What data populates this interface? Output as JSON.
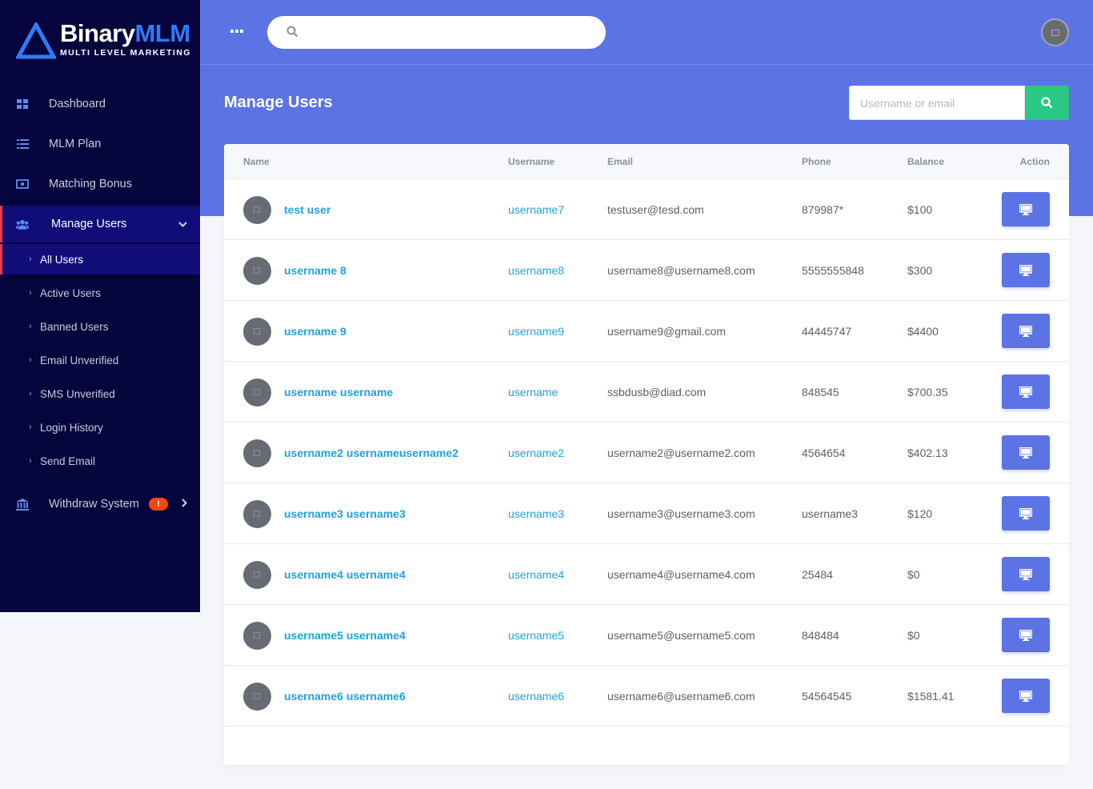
{
  "brand": {
    "name_part1": "Binary",
    "name_part2": "MLM",
    "tagline": "MULTI LEVEL MARKETING"
  },
  "sidebar": {
    "items": [
      {
        "label": "Dashboard",
        "icon": "dashboard-icon"
      },
      {
        "label": "MLM Plan",
        "icon": "list-icon"
      },
      {
        "label": "Matching Bonus",
        "icon": "money-icon"
      },
      {
        "label": "Manage Users",
        "icon": "users-icon"
      },
      {
        "label": "Withdraw System",
        "icon": "bank-icon",
        "badge": "!"
      }
    ],
    "subitems": [
      {
        "label": "All Users"
      },
      {
        "label": "Active Users"
      },
      {
        "label": "Banned Users"
      },
      {
        "label": "Email Unverified"
      },
      {
        "label": "SMS Unverified"
      },
      {
        "label": "Login History"
      },
      {
        "label": "Send Email"
      }
    ]
  },
  "topbar": {
    "search_placeholder": ""
  },
  "page": {
    "title": "Manage Users",
    "search_placeholder": "Username or email"
  },
  "table": {
    "columns": [
      "Name",
      "Username",
      "Email",
      "Phone",
      "Balance",
      "Action"
    ],
    "rows": [
      {
        "name": "test user",
        "username": "username7",
        "email": "testuser@tesd.com",
        "phone": "879987*",
        "balance": "$100"
      },
      {
        "name": "username 8",
        "username": "username8",
        "email": "username8@username8.com",
        "phone": "5555555848",
        "balance": "$300"
      },
      {
        "name": "username 9",
        "username": "username9",
        "email": "username9@gmail.com",
        "phone": "44445747",
        "balance": "$4400"
      },
      {
        "name": "username username",
        "username": "username",
        "email": "ssbdusb@diad.com",
        "phone": "848545",
        "balance": "$700.35"
      },
      {
        "name": "username2 usernameusername2",
        "username": "username2",
        "email": "username2@username2.com",
        "phone": "4564654",
        "balance": "$402.13"
      },
      {
        "name": "username3 username3",
        "username": "username3",
        "email": "username3@username3.com",
        "phone": "username3",
        "balance": "$120"
      },
      {
        "name": "username4 username4",
        "username": "username4",
        "email": "username4@username4.com",
        "phone": "25484",
        "balance": "$0"
      },
      {
        "name": "username5 username4",
        "username": "username5",
        "email": "username5@username5.com",
        "phone": "848484",
        "balance": "$0"
      },
      {
        "name": "username6 username6",
        "username": "username6",
        "email": "username6@username6.com",
        "phone": "54564545",
        "balance": "$1581.41"
      }
    ]
  },
  "colors": {
    "sidebar": "#05043c",
    "active": "#100d78",
    "accent": "#5c73e6",
    "link": "#1fa2e0",
    "success": "#29c983",
    "alert": "#f5470f"
  }
}
